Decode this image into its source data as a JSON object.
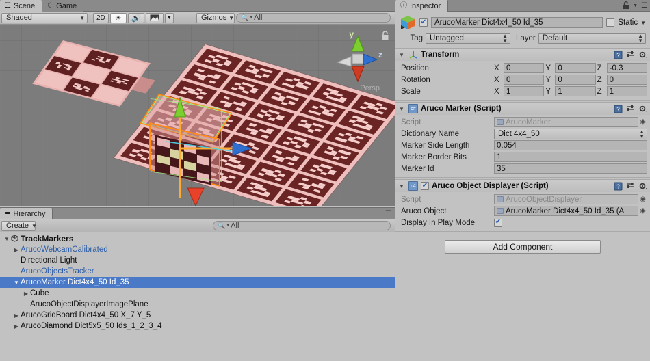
{
  "scene_panel": {
    "tabs": [
      {
        "label": "Scene",
        "icon": "grid-icon",
        "active": true
      },
      {
        "label": "Game",
        "icon": "gamepad-icon",
        "active": false
      }
    ],
    "toolbar": {
      "draw_mode": "Shaded",
      "mode_2d": "2D",
      "lighting_icon": "sun-icon",
      "audio_icon": "speaker-icon",
      "fx_icon": "image-icon",
      "fx_chevron": "chevron-down-icon",
      "gizmos": "Gizmos",
      "search_placeholder": "All",
      "search_value": "",
      "search_icon": "search-icon"
    },
    "viewport": {
      "axis_y_label": "y",
      "axis_z_label": "z",
      "projection_label": "Persp",
      "lock_icon": "lock-icon"
    }
  },
  "hierarchy_panel": {
    "tab": {
      "label": "Hierarchy",
      "icon": "list-icon"
    },
    "toolbar": {
      "create_label": "Create",
      "create_chevron": "chevron-down-icon",
      "search_placeholder": "All",
      "search_value": "",
      "search_icon": "search-icon"
    },
    "items": [
      {
        "label": "TrackMarkers",
        "depth": 0,
        "expanded": true,
        "arrow": "triangle-down",
        "selected": false,
        "prefab": false,
        "root": true,
        "icon": "scene-icon"
      },
      {
        "label": "ArucoWebcamCalibrated",
        "depth": 1,
        "expanded": false,
        "arrow": "triangle-right",
        "selected": false,
        "prefab": true,
        "root": false,
        "icon": ""
      },
      {
        "label": "Directional Light",
        "depth": 1,
        "expanded": null,
        "arrow": "",
        "selected": false,
        "prefab": false,
        "root": false,
        "icon": ""
      },
      {
        "label": "ArucoObjectsTracker",
        "depth": 1,
        "expanded": null,
        "arrow": "",
        "selected": false,
        "prefab": true,
        "root": false,
        "icon": ""
      },
      {
        "label": "ArucoMarker Dict4x4_50 Id_35",
        "depth": 1,
        "expanded": true,
        "arrow": "triangle-down",
        "selected": true,
        "prefab": true,
        "root": false,
        "icon": ""
      },
      {
        "label": "Cube",
        "depth": 2,
        "expanded": false,
        "arrow": "triangle-right",
        "selected": false,
        "prefab": false,
        "root": false,
        "icon": ""
      },
      {
        "label": "ArucoObjectDisplayerImagePlane",
        "depth": 2,
        "expanded": null,
        "arrow": "",
        "selected": false,
        "prefab": false,
        "root": false,
        "icon": ""
      },
      {
        "label": "ArucoGridBoard Dict4x4_50 X_7 Y_5",
        "depth": 1,
        "expanded": false,
        "arrow": "triangle-right",
        "selected": false,
        "prefab": false,
        "root": false,
        "icon": ""
      },
      {
        "label": "ArucoDiamond Dict5x5_50 Ids_1_2_3_4",
        "depth": 1,
        "expanded": false,
        "arrow": "triangle-right",
        "selected": false,
        "prefab": false,
        "root": false,
        "icon": ""
      }
    ]
  },
  "inspector": {
    "tab": {
      "label": "Inspector",
      "icon": "info-icon"
    },
    "lock_icon": "lock-icon",
    "menu_icon": "hamburger-icon",
    "object": {
      "enabled": true,
      "name": "ArucoMarker Dict4x4_50 Id_35",
      "icon": "prefab-cube-icon",
      "static_label": "Static",
      "static_checked": false,
      "static_chevron": "chevron-down-icon",
      "tag_label": "Tag",
      "tag_value": "Untagged",
      "layer_label": "Layer",
      "layer_value": "Default"
    },
    "components": [
      {
        "title": "Transform",
        "icon": "transform-axis-icon",
        "expanded": true,
        "has_enable_checkbox": false,
        "help_icon": "help-book-icon",
        "preset_icon": "preset-icon",
        "gear_icon": "gear-icon",
        "vectors": [
          {
            "label": "Position",
            "x": "0",
            "y": "0",
            "z": "-0.3"
          },
          {
            "label": "Rotation",
            "x": "0",
            "y": "0",
            "z": "0"
          },
          {
            "label": "Scale",
            "x": "1",
            "y": "1",
            "z": "1"
          }
        ],
        "axis_labels": [
          "X",
          "Y",
          "Z"
        ]
      },
      {
        "title": "Aruco Marker (Script)",
        "icon": "csharp-script-icon",
        "expanded": true,
        "has_enable_checkbox": false,
        "help_icon": "help-book-icon",
        "preset_icon": "preset-icon",
        "gear_icon": "gear-icon",
        "fields": [
          {
            "type": "objref-readonly",
            "label": "Script",
            "value": "ArucoMarker",
            "picker": "picker-icon"
          },
          {
            "type": "popup",
            "label": "Dictionary Name",
            "value": "Dict 4x4_50"
          },
          {
            "type": "text",
            "label": "Marker Side Length",
            "value": "0.054"
          },
          {
            "type": "text",
            "label": "Marker Border Bits",
            "value": "1"
          },
          {
            "type": "text",
            "label": "Marker Id",
            "value": "35"
          }
        ]
      },
      {
        "title": "Aruco Object Displayer (Script)",
        "icon": "csharp-script-icon",
        "expanded": true,
        "has_enable_checkbox": true,
        "enabled": true,
        "help_icon": "help-book-icon",
        "preset_icon": "preset-icon",
        "gear_icon": "gear-icon",
        "fields": [
          {
            "type": "objref-readonly",
            "label": "Script",
            "value": "ArucoObjectDisplayer",
            "picker": "picker-icon"
          },
          {
            "type": "objref",
            "label": "Aruco Object",
            "value": "ArucoMarker Dict4x4_50 Id_35 (A",
            "picker": "picker-icon"
          },
          {
            "type": "checkbox",
            "label": "Display In Play Mode",
            "checked": true
          }
        ]
      }
    ],
    "add_component_label": "Add Component"
  },
  "colors": {
    "panel_bg": "#c2c2c2",
    "tab_inactive": "#8a8a8a",
    "selection_blue": "#4a79c8",
    "prefab_text": "#2b5da8",
    "gizmo_orange": "#ff8c15",
    "axis_x": "#d33b2c",
    "axis_y": "#7ccf2e",
    "axis_z": "#2f6fd0",
    "marker_dark": "#6a2424",
    "marker_light": "#f6cfcd",
    "viewport_bg": "#7c7c7c"
  }
}
